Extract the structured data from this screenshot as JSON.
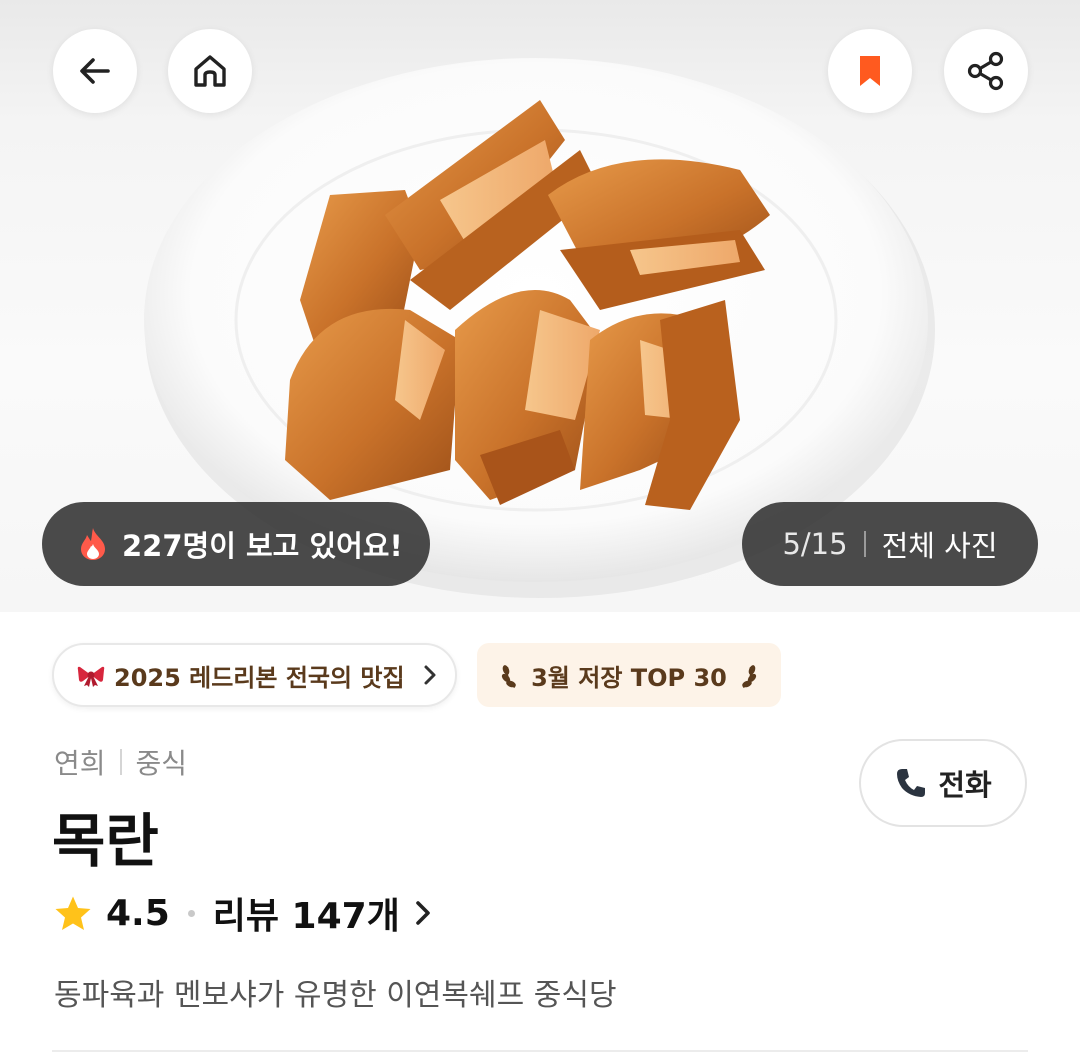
{
  "hero": {
    "photo_alt": "",
    "viewers_text": "227명이 보고 있어요!",
    "photo_counter": "5/15",
    "all_photos_label": "전체 사진"
  },
  "topbar": {
    "back_icon": "arrow-left-icon",
    "home_icon": "home-icon",
    "bookmark_icon": "bookmark-icon",
    "share_icon": "share-icon",
    "bookmark_color": "#ff5a1f"
  },
  "badges": {
    "redribbon_label": "2025 레드리본 전국의 맛집",
    "top_label": "3월 저장 TOP 30"
  },
  "restaurant": {
    "region": "연희",
    "cuisine": "중식",
    "name": "목란",
    "rating": "4.5",
    "reviews_label": "리뷰 147개",
    "description": "동파육과 멘보샤가 유명한 이연복쉐프 중식당"
  },
  "actions": {
    "call_label": "전화"
  },
  "colors": {
    "accent": "#ff5a1f",
    "star": "#ffc21a",
    "ribbon_tag_bg": "#ffffff",
    "top_tag_bg": "#fdf3e8"
  }
}
